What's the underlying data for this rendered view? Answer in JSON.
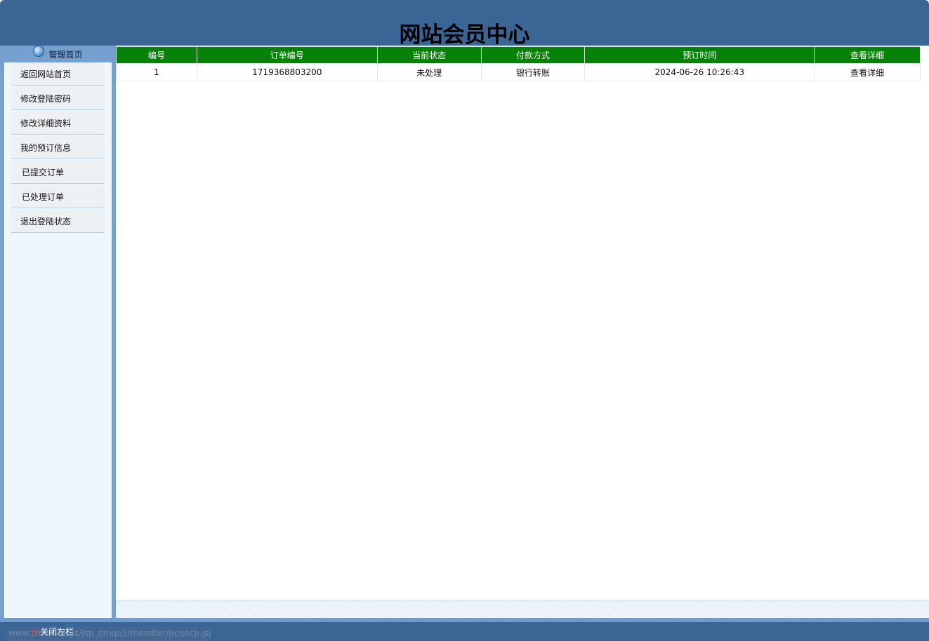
{
  "header": {
    "title": "网站会员中心"
  },
  "sidebar": {
    "heading": "管理首页",
    "items": [
      {
        "label": "返回网站首页"
      },
      {
        "label": "修改登陆密码"
      },
      {
        "label": "修改详细资料"
      },
      {
        "label": "我的预订信息"
      },
      {
        "label": "已提交订单"
      },
      {
        "label": "已处理订单"
      },
      {
        "label": "退出登陆状态"
      }
    ]
  },
  "orders_table": {
    "headers": [
      "编号",
      "订单编号",
      "当前状态",
      "付款方式",
      "预订时间",
      "查看详细"
    ],
    "rows": [
      [
        "1",
        "1719368803200",
        "未处理",
        "银行转账",
        "2024-06-26 10:26:43",
        "查看详细"
      ]
    ]
  },
  "footer": {
    "close_sidebar": "关闭左栏",
    "status_url": "www.zh...d.../sys/jsp_gmqq5/member/pcqecp.jsp"
  },
  "colors": {
    "header_bg": "#3a6594",
    "sidebar_bg": "#75a0d0",
    "table_header_bg": "#078107"
  }
}
